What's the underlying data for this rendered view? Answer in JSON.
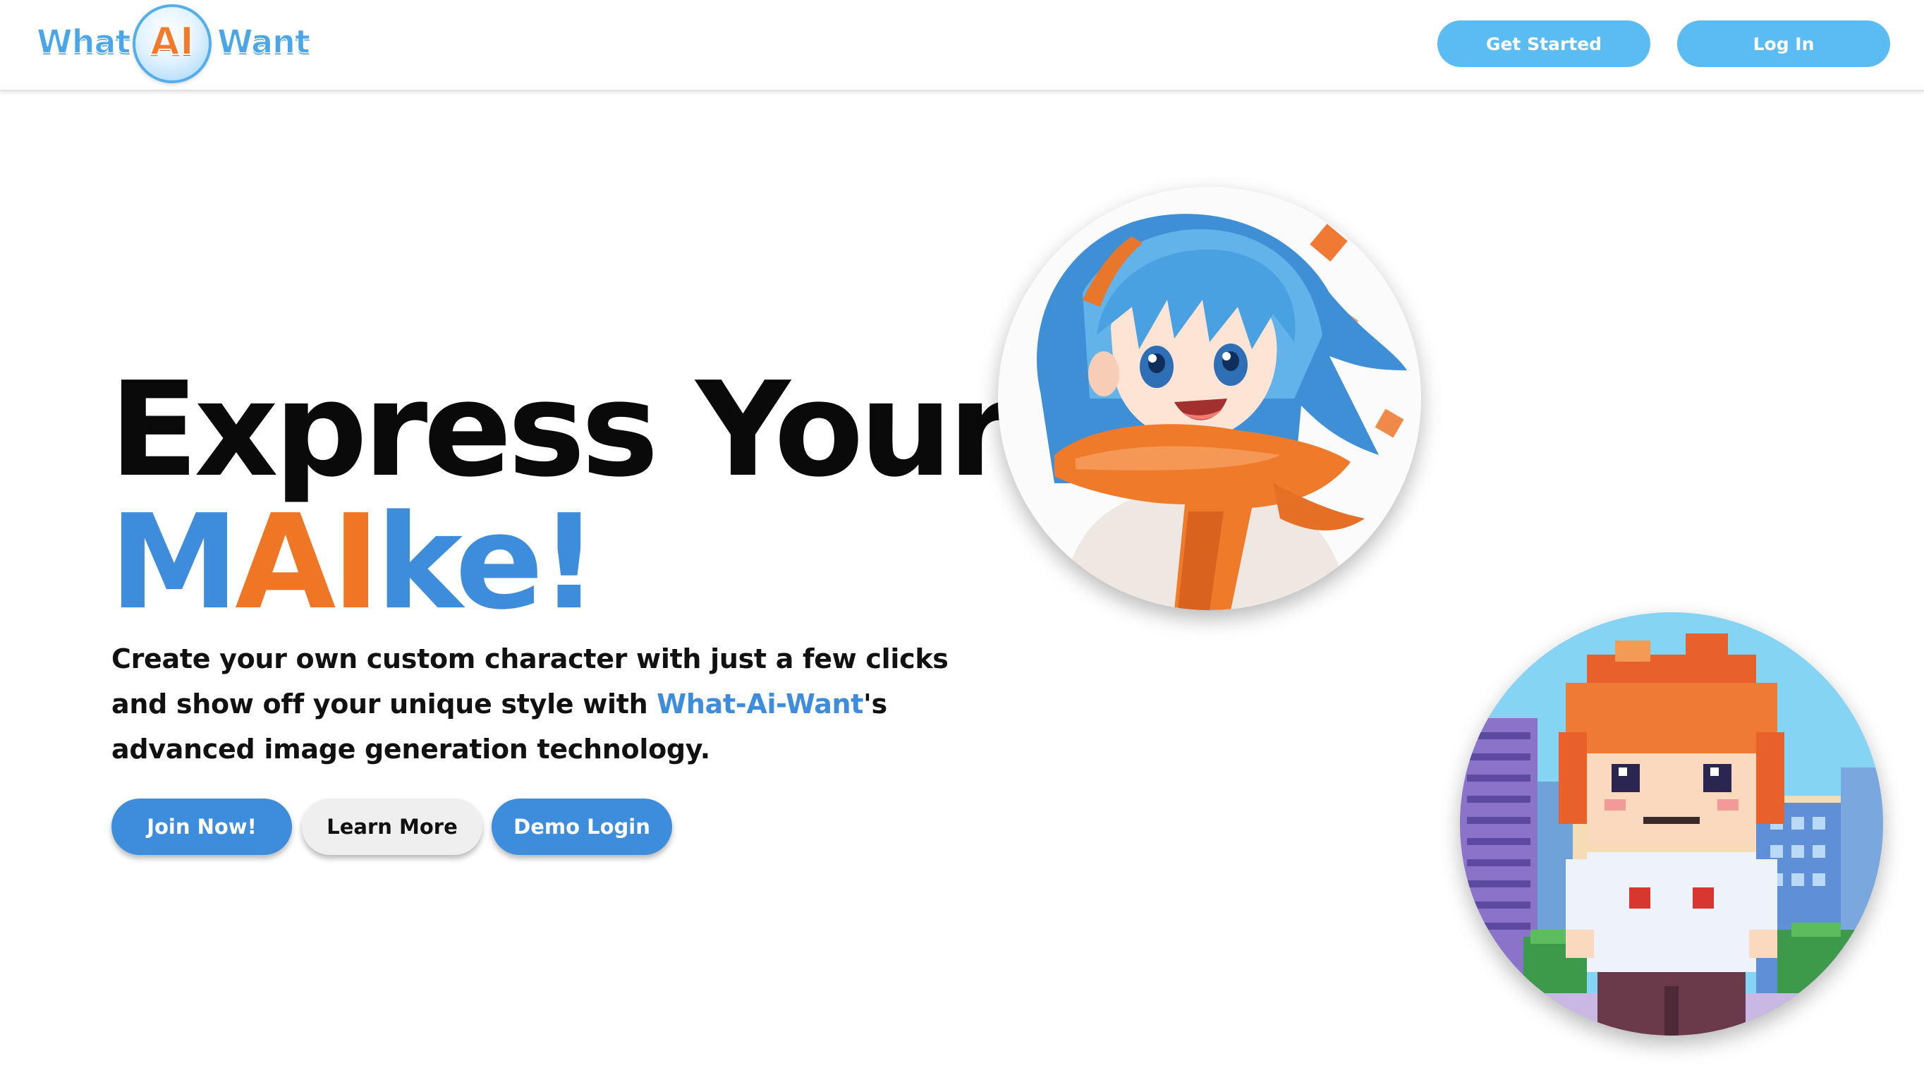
{
  "nav": {
    "logo": {
      "word_left": "What",
      "word_center": "AI",
      "word_right": "Want"
    },
    "get_started_label": "Get Started",
    "log_in_label": "Log In"
  },
  "hero": {
    "heading_line1": "Express Your",
    "heading_line2_part1": "M",
    "heading_line2_part2": "AI",
    "heading_line2_part3": "ke!",
    "description_before": "Create your own custom character with just a few clicks and show off your unique style with ",
    "description_brand": "What-Ai-Want",
    "description_after": "'s advanced image generation technology.",
    "buttons": {
      "join_label": "Join Now!",
      "learn_label": "Learn More",
      "demo_label": "Demo Login"
    }
  },
  "images": {
    "anime_portrait_icon": "anime-girl-scarf-portrait",
    "pixel_portrait_icon": "pixel-art-boy-city-portrait"
  },
  "colors": {
    "brand_blue": "#3d8ddc",
    "brand_orange": "#ef7625",
    "nav_button": "#5bbcf3"
  }
}
